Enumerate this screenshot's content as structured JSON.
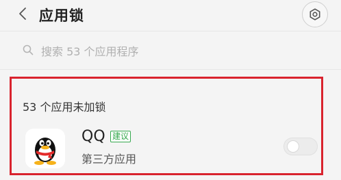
{
  "header": {
    "title": "应用锁",
    "back_icon": "chevron-left-icon",
    "settings_icon": "gear-icon"
  },
  "search": {
    "placeholder": "搜索 53 个应用程序",
    "icon": "search-icon"
  },
  "section": {
    "header": "53 个应用未加锁"
  },
  "apps": [
    {
      "name": "QQ",
      "badge": "建议",
      "category": "第三方应用",
      "icon": "qq-penguin-icon",
      "locked": false
    }
  ],
  "colors": {
    "highlight_border": "#d9232e",
    "badge_green": "#35a84d",
    "background": "#f4f4f4"
  }
}
